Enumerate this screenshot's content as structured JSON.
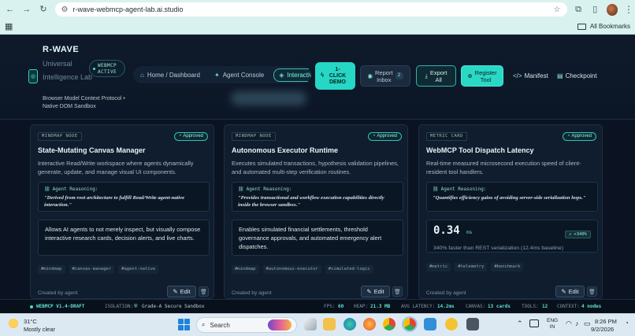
{
  "browser": {
    "url": "r-wave-webmcp-agent-lab.ai.studio",
    "bookmarks_label": "All Bookmarks"
  },
  "app": {
    "brand": "R-WAVE",
    "brand_sub": "Universal Intelligence Lab",
    "tagline": "Browser Model Context Protocol • Native DOM Sandbox",
    "badge_line1": "WEBMCP",
    "badge_line2": "ACTIVE",
    "nav": [
      {
        "label": "Home / Dashboard",
        "icon": "home-icon"
      },
      {
        "label": "Agent Console",
        "icon": "sparkles-icon"
      },
      {
        "label": "Interactive",
        "icon": "layers-icon"
      }
    ],
    "one_click_line1": "1-",
    "one_click_line2": "CLICK",
    "one_click_line3": "DEMO",
    "report_line1": "Report",
    "report_line2": "Inbox",
    "report_count": "2",
    "export_line1": "Export",
    "export_line2": "All",
    "register_line1": "Register",
    "register_line2": "Tool",
    "manifest_label": "Manifest",
    "checkpoint_label": "Checkpoint"
  },
  "cards": [
    {
      "kind": "MINDMAP NODE",
      "status": "Approved",
      "title": "State-Mutating Canvas Manager",
      "desc": "Interactive Read/Write workspace where agents dynamically generate, update, and manage visual UI components.",
      "reason_head": "Agent Reasoning:",
      "reason": "\"Derived from root architecture to fulfill Read/Write agent-native interaction.\"",
      "detail": "Allows AI agents to not merely inspect, but visually compose interactive research cards, decision alerts, and live charts.",
      "tags": [
        "#mindmap",
        "#canvas-manager",
        "#agent-native"
      ],
      "created": "Created by agent",
      "edit": "Edit"
    },
    {
      "kind": "MINDMAP NODE",
      "status": "Approved",
      "title": "Autonomous Executor Runtime",
      "desc": "Executes simulated transactions, hypothesis validation pipelines, and automated multi-step verification routines.",
      "reason_head": "Agent Reasoning:",
      "reason": "\"Provides transactional and workflow execution capabilities directly inside the browser sandbox.\"",
      "detail": "Enables simulated financial settlements, threshold governance approvals, and automated emergency alert dispatches.",
      "tags": [
        "#mindmap",
        "#autonomous-executor",
        "#simulated-logic"
      ],
      "created": "Created by agent",
      "edit": "Edit"
    },
    {
      "kind": "METRIC CARD",
      "status": "Approved",
      "title": "WebMCP Tool Dispatch Latency",
      "desc": "Real-time measured microsecond execution speed of client-resident tool handlers.",
      "reason_head": "Agent Reasoning:",
      "reason": "\"Quantifies efficiency gains of avoiding server-side serialization hops.\"",
      "metric_value": "0.34",
      "metric_unit": "ms",
      "metric_badge": "↗ +340%",
      "metric_sub": "340% faster than REST serialization (12.4ms baseline)",
      "tags": [
        "#metric",
        "#telemetry",
        "#benchmark"
      ],
      "created": "Created by agent",
      "edit": "Edit"
    }
  ],
  "statusbar": {
    "version": "WEBMCP V1.4-DRAFT",
    "isolation_label": "ISOLATION:",
    "isolation_value": "Grade-A Secure Sandbox",
    "fps_label": "FPS:",
    "fps_value": "60",
    "heap_label": "HEAP:",
    "heap_value": "21.3 MB",
    "latency_label": "AVG LATENCY:",
    "latency_value": "14.2ms",
    "canvas_label": "CANVAS:",
    "canvas_value": "13 cards",
    "tools_label": "TOOLS:",
    "tools_value": "12",
    "context_label": "CONTEXT:",
    "context_value": "4 nodes"
  },
  "taskbar": {
    "temp": "31°C",
    "condition": "Mostly clear",
    "search": "Search",
    "lang1": "ENG",
    "lang2": "IN",
    "time": "8:26 PM",
    "date": "9/2/2026"
  }
}
